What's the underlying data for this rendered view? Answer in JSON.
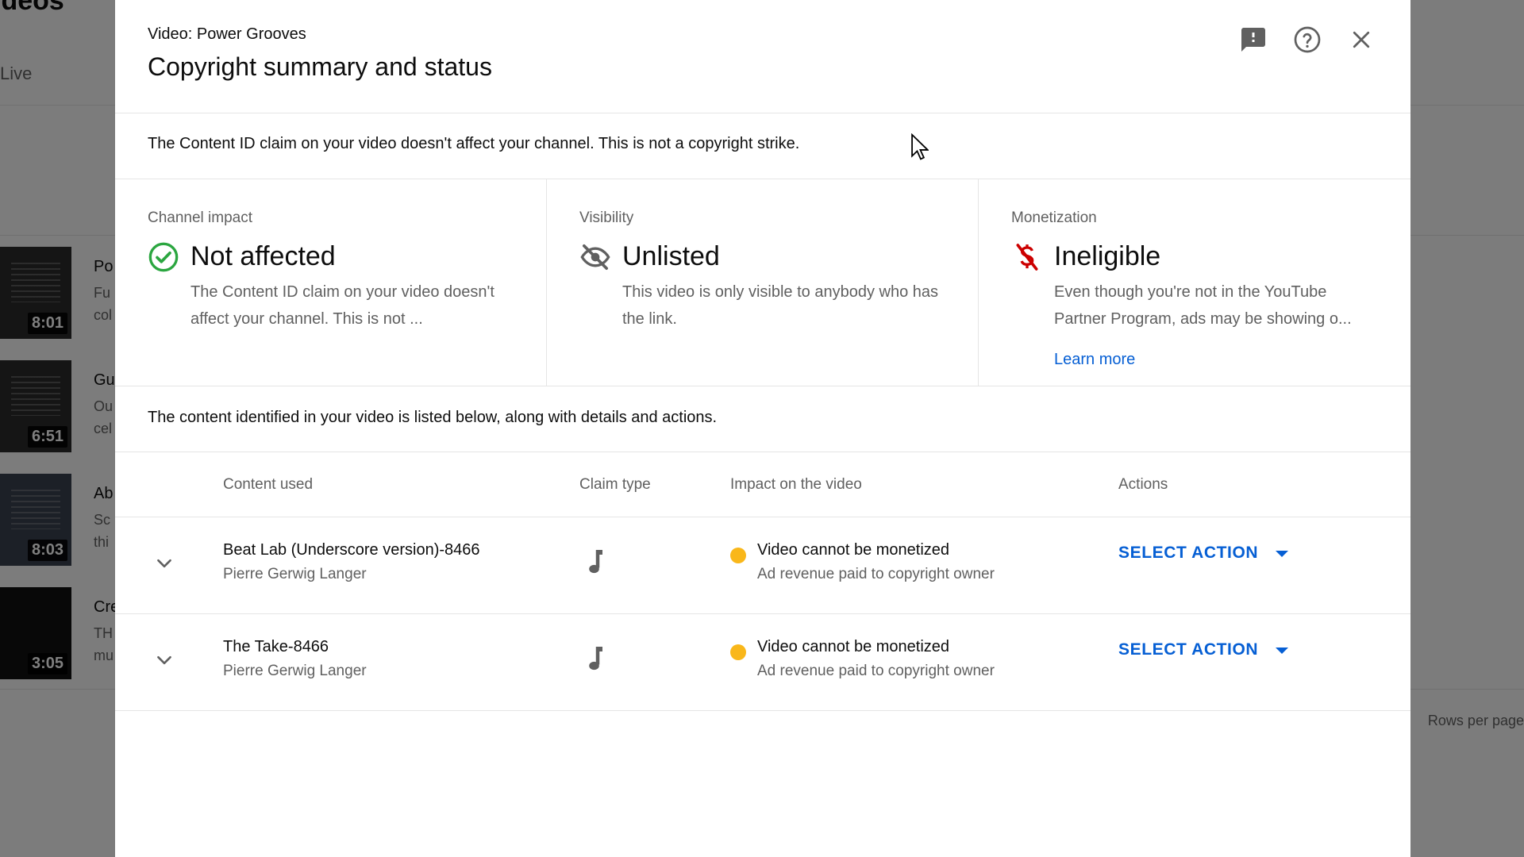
{
  "background": {
    "page_title": "ideos",
    "tab": "Live",
    "rows": [
      {
        "title": "Po",
        "desc": "Fu col",
        "duration": "8:01"
      },
      {
        "title": "Gu",
        "desc": "Ou cel",
        "duration": "6:51"
      },
      {
        "title": "Ab",
        "desc": "Sc thi",
        "duration": "8:03"
      },
      {
        "title": "Cre",
        "desc": "TH mu",
        "duration": "3:05"
      }
    ],
    "rows_per_page": "Rows per page"
  },
  "dialog": {
    "subtitle": "Video: Power Grooves",
    "title": "Copyright summary and status",
    "icons": {
      "feedback": "feedback-icon",
      "help": "help-icon",
      "close": "close-icon"
    },
    "notice": "The Content ID claim on your video doesn't affect your channel. This is not a copyright strike.",
    "cards": {
      "channel_impact": {
        "label": "Channel impact",
        "value": "Not affected",
        "desc": "The Content ID claim on your video doesn't affect your channel. This is not ...",
        "icon": "check-circle-icon",
        "color": "#2ba640"
      },
      "visibility": {
        "label": "Visibility",
        "value": "Unlisted",
        "desc": "This video is only visible to anybody who has the link.",
        "icon": "eye-off-icon"
      },
      "monetization": {
        "label": "Monetization",
        "value": "Ineligible",
        "desc": "Even though you're not in the YouTube Partner Program, ads may be showing o...",
        "link": "Learn more",
        "icon": "no-money-icon",
        "color": "#cc0000"
      }
    },
    "listed_text": "The content identified in your video is listed below, along with details and actions.",
    "table": {
      "headers": {
        "content": "Content used",
        "claim": "Claim type",
        "impact": "Impact on the video",
        "actions": "Actions"
      },
      "rows": [
        {
          "title": "Beat Lab (Underscore version)-8466",
          "owner": "Pierre Gerwig Langer",
          "claim_icon": "music-note-icon",
          "impact": "Video cannot be monetized",
          "impact_sub": "Ad revenue paid to copyright owner",
          "action": "SELECT ACTION"
        },
        {
          "title": "The Take-8466",
          "owner": "Pierre Gerwig Langer",
          "claim_icon": "music-note-icon",
          "impact": "Video cannot be monetized",
          "impact_sub": "Ad revenue paid to copyright owner",
          "action": "SELECT ACTION"
        }
      ]
    },
    "colors": {
      "link": "#065fd4",
      "status_warning": "#f9b71a"
    }
  }
}
